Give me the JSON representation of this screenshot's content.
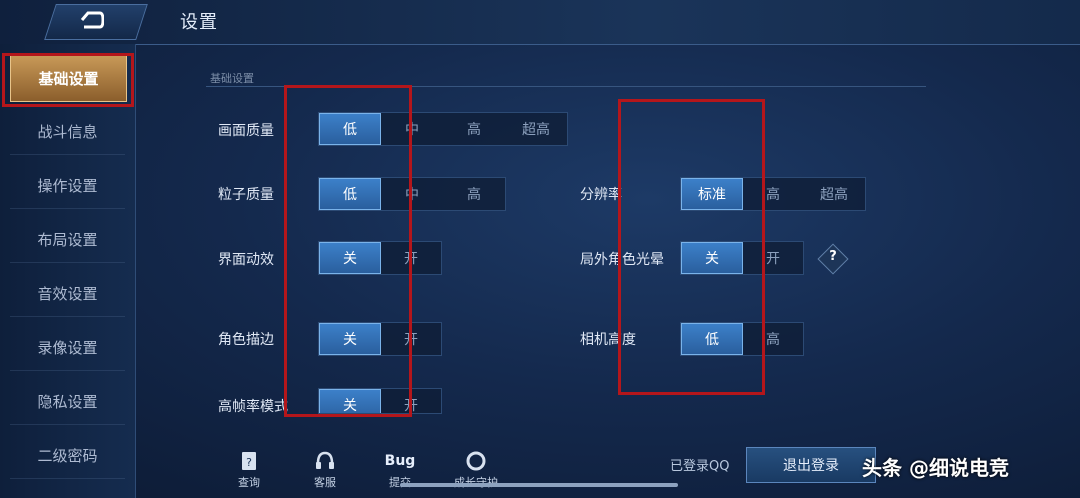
{
  "header": {
    "title": "设置"
  },
  "sidebar": {
    "items": [
      {
        "label": "基础设置",
        "active": true
      },
      {
        "label": "战斗信息",
        "active": false
      },
      {
        "label": "操作设置",
        "active": false
      },
      {
        "label": "布局设置",
        "active": false
      },
      {
        "label": "音效设置",
        "active": false
      },
      {
        "label": "录像设置",
        "active": false
      },
      {
        "label": "隐私设置",
        "active": false
      },
      {
        "label": "二级密码",
        "active": false
      }
    ]
  },
  "section": {
    "title": "基础设置"
  },
  "settings": {
    "image_quality": {
      "label": "画面质量",
      "options": [
        "低",
        "中",
        "高",
        "超高"
      ],
      "selected": "低"
    },
    "particle_quality": {
      "label": "粒子质量",
      "options": [
        "低",
        "中",
        "高"
      ],
      "selected": "低"
    },
    "ui_animation": {
      "label": "界面动效",
      "options": [
        "关",
        "开"
      ],
      "selected": "关"
    },
    "character_outline": {
      "label": "角色描边",
      "options": [
        "关",
        "开"
      ],
      "selected": "关"
    },
    "high_fps": {
      "label": "高帧率模式",
      "options": [
        "关",
        "开"
      ],
      "selected": "关"
    },
    "resolution": {
      "label": "分辨率",
      "options": [
        "标准",
        "高",
        "超高"
      ],
      "selected": "标准"
    },
    "outer_glow": {
      "label": "局外角色光晕",
      "options": [
        "关",
        "开"
      ],
      "selected": "关",
      "help": "?"
    },
    "camera_height": {
      "label": "相机高度",
      "options": [
        "低",
        "高"
      ],
      "selected": "低"
    }
  },
  "footer": {
    "query": "查询",
    "support": "客服",
    "bug_icon": "Bug",
    "bug": "提交",
    "guardian": "成长守护",
    "login_status": "已登录QQ",
    "logout": "退出登录",
    "watermark": "头条 @细说电竞"
  },
  "colors": {
    "highlight": "#b4161b",
    "selected": "#3c80c9",
    "active_tab": "#c99a58"
  }
}
